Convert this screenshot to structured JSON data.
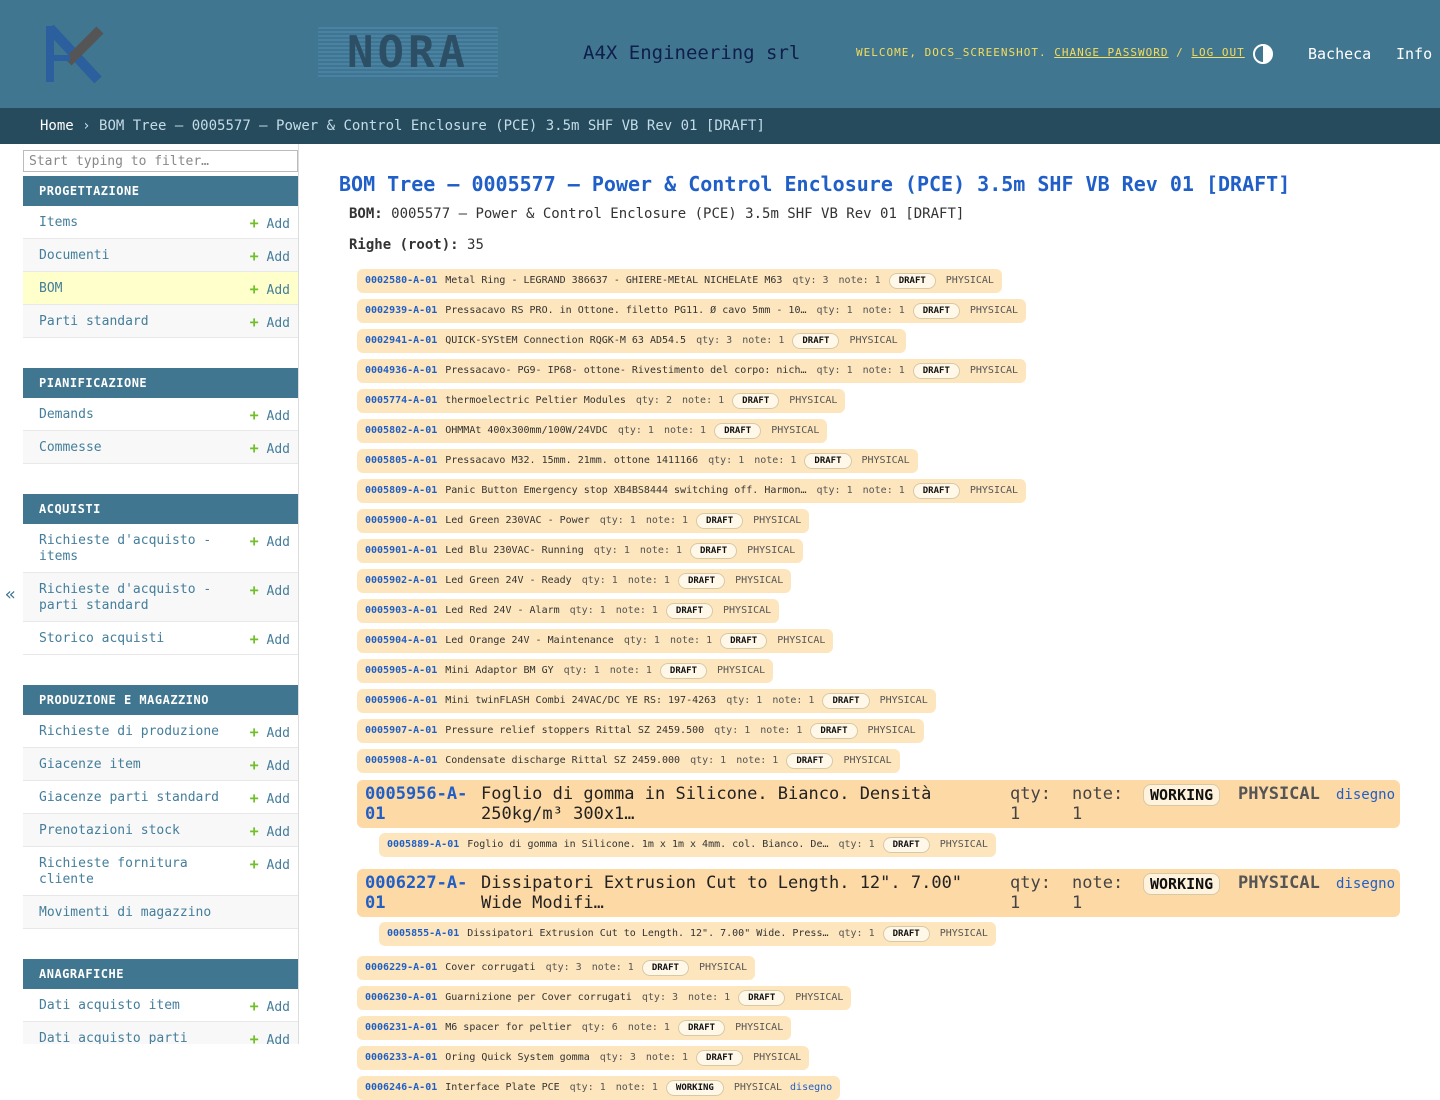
{
  "header": {
    "logo_text": "NORA",
    "company": "A4X Engineering srl",
    "welcome": "WELCOME, DOCS_SCREENSHOT.",
    "change_password": "CHANGE PASSWORD",
    "separator": "/",
    "logout": "LOG OUT",
    "nav_bacheca": "Bacheca",
    "nav_info": "Info"
  },
  "breadcrumbs": {
    "home": "Home",
    "sep": "›",
    "current": "BOM Tree — 0005577 — Power & Control Enclosure (PCE) 3.5m SHF VB Rev 01 [DRAFT]"
  },
  "sidebar": {
    "filter_placeholder": "Start typing to filter…",
    "add_label": "Add",
    "collapse": "«",
    "modules": [
      {
        "title": "PROGETTAZIONE",
        "items": [
          "Items",
          "Documenti",
          "BOM",
          "Parti standard"
        ]
      },
      {
        "title": "PIANIFICAZIONE",
        "items": [
          "Demands",
          "Commesse"
        ]
      },
      {
        "title": "ACQUISTI",
        "items": [
          "Richieste d'acquisto - items",
          "Richieste d'acquisto - parti standard",
          "Storico acquisti"
        ]
      },
      {
        "title": "PRODUZIONE E MAGAZZINO",
        "items": [
          "Richieste di produzione",
          "Giacenze item",
          "Giacenze parti standard",
          "Prenotazioni stock",
          "Richieste fornitura cliente",
          "Movimenti di magazzino"
        ]
      },
      {
        "title": "ANAGRAFICHE",
        "items": [
          "Dati acquisto item",
          "Dati acquisto parti"
        ]
      }
    ]
  },
  "main": {
    "title": "BOM Tree — 0005577 — Power & Control Enclosure (PCE) 3.5m SHF VB Rev 01 [DRAFT]",
    "bom_label": "BOM:",
    "bom_value": "0005577 — Power & Control Enclosure (PCE) 3.5m SHF VB Rev 01 [DRAFT]",
    "righe_label": "Righe (root):",
    "righe_value": "35"
  },
  "rows": [
    {
      "code": "0002580-A-01",
      "name": "Metal Ring - LEGRAND 386637 - GHIERE-MEtAL NICHELAtE M63",
      "qty": "qty: 3",
      "note": "note: 1",
      "status": "DRAFT",
      "type": "PHYSICAL"
    },
    {
      "code": "0002939-A-01",
      "name": "Pressacavo RS PRO. in Ottone. filetto PG11. Ø cavo 5mm - 10…",
      "qty": "qty: 1",
      "note": "note: 1",
      "status": "DRAFT",
      "type": "PHYSICAL"
    },
    {
      "code": "0002941-A-01",
      "name": "QUICK-SYStEM Connection RQGK-M 63 AD54.5",
      "qty": "qty: 3",
      "note": "note: 1",
      "status": "DRAFT",
      "type": "PHYSICAL"
    },
    {
      "code": "0004936-A-01",
      "name": "Pressacavo- PG9- IP68- ottone- Rivestimento del corpo: nich…",
      "qty": "qty: 1",
      "note": "note: 1",
      "status": "DRAFT",
      "type": "PHYSICAL"
    },
    {
      "code": "0005774-A-01",
      "name": "thermoelectric Peltier Modules",
      "qty": "qty: 2",
      "note": "note: 1",
      "status": "DRAFT",
      "type": "PHYSICAL"
    },
    {
      "code": "0005802-A-01",
      "name": "OHMMAt 400x300mm/100W/24VDC",
      "qty": "qty: 1",
      "note": "note: 1",
      "status": "DRAFT",
      "type": "PHYSICAL"
    },
    {
      "code": "0005805-A-01",
      "name": "Pressacavo M32. 15mm. 21mm. ottone 1411166",
      "qty": "qty: 1",
      "note": "note: 1",
      "status": "DRAFT",
      "type": "PHYSICAL"
    },
    {
      "code": "0005809-A-01",
      "name": "Panic Button Emergency stop XB4BS8444 switching off. Harmon…",
      "qty": "qty: 1",
      "note": "note: 1",
      "status": "DRAFT",
      "type": "PHYSICAL"
    },
    {
      "code": "0005900-A-01",
      "name": "Led Green 230VAC - Power",
      "qty": "qty: 1",
      "note": "note: 1",
      "status": "DRAFT",
      "type": "PHYSICAL"
    },
    {
      "code": "0005901-A-01",
      "name": "Led Blu 230VAC- Running",
      "qty": "qty: 1",
      "note": "note: 1",
      "status": "DRAFT",
      "type": "PHYSICAL"
    },
    {
      "code": "0005902-A-01",
      "name": "Led Green 24V - Ready",
      "qty": "qty: 1",
      "note": "note: 1",
      "status": "DRAFT",
      "type": "PHYSICAL"
    },
    {
      "code": "0005903-A-01",
      "name": "Led Red 24V - Alarm",
      "qty": "qty: 1",
      "note": "note: 1",
      "status": "DRAFT",
      "type": "PHYSICAL"
    },
    {
      "code": "0005904-A-01",
      "name": "Led Orange 24V - Maintenance",
      "qty": "qty: 1",
      "note": "note: 1",
      "status": "DRAFT",
      "type": "PHYSICAL"
    },
    {
      "code": "0005905-A-01",
      "name": "Mini Adaptor BM GY",
      "qty": "qty: 1",
      "note": "note: 1",
      "status": "DRAFT",
      "type": "PHYSICAL"
    },
    {
      "code": "0005906-A-01",
      "name": "Mini twinFLASH Combi 24VAC/DC YE RS: 197-4263",
      "qty": "qty: 1",
      "note": "note: 1",
      "status": "DRAFT",
      "type": "PHYSICAL"
    },
    {
      "code": "0005907-A-01",
      "name": "Pressure relief stoppers Rittal SZ 2459.500",
      "qty": "qty: 1",
      "note": "note: 1",
      "status": "DRAFT",
      "type": "PHYSICAL"
    },
    {
      "code": "0005908-A-01",
      "name": "Condensate discharge Rittal SZ 2459.000",
      "qty": "qty: 1",
      "note": "note: 1",
      "status": "DRAFT",
      "type": "PHYSICAL"
    }
  ],
  "big1": {
    "code": "0005956-A-01",
    "name": "Foglio di gomma in Silicone. Bianco. Densità 250kg/m³ 300x1…",
    "qty": "qty: 1",
    "note": "note: 1",
    "status": "WORKING",
    "type": "PHYSICAL",
    "link": "disegno"
  },
  "child1": {
    "code": "0005889-A-01",
    "name": "Foglio di gomma in Silicone. 1m x 1m x 4mm. col. Bianco. De…",
    "qty": "qty: 1",
    "status": "DRAFT",
    "type": "PHYSICAL"
  },
  "big2": {
    "code": "0006227-A-01",
    "name": "Dissipatori Extrusion Cut to Length. 12\". 7.00\" Wide Modifi…",
    "qty": "qty: 1",
    "note": "note: 1",
    "status": "WORKING",
    "type": "PHYSICAL",
    "link": "disegno"
  },
  "child2": {
    "code": "0005855-A-01",
    "name": "Dissipatori Extrusion Cut to Length. 12\". 7.00\" Wide. Press…",
    "qty": "qty: 1",
    "status": "DRAFT",
    "type": "PHYSICAL"
  },
  "rows2": [
    {
      "code": "0006229-A-01",
      "name": "Cover corrugati",
      "qty": "qty: 3",
      "note": "note: 1",
      "status": "DRAFT",
      "type": "PHYSICAL"
    },
    {
      "code": "0006230-A-01",
      "name": "Guarnizione per Cover corrugati",
      "qty": "qty: 3",
      "note": "note: 1",
      "status": "DRAFT",
      "type": "PHYSICAL"
    },
    {
      "code": "0006231-A-01",
      "name": "M6 spacer for peltier",
      "qty": "qty: 6",
      "note": "note: 1",
      "status": "DRAFT",
      "type": "PHYSICAL"
    },
    {
      "code": "0006233-A-01",
      "name": "Oring Quick System gomma",
      "qty": "qty: 3",
      "note": "note: 1",
      "status": "DRAFT",
      "type": "PHYSICAL"
    },
    {
      "code": "0006246-A-01",
      "name": "Interface Plate PCE",
      "qty": "qty: 1",
      "note": "note: 1",
      "status": "WORKING",
      "type": "PHYSICAL",
      "link": "disegno"
    }
  ]
}
